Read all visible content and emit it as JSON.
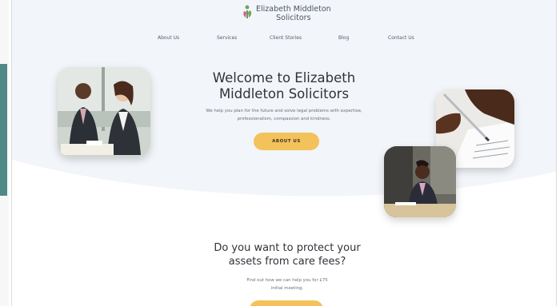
{
  "brand": {
    "name_line1": "Elizabeth Middleton",
    "name_line2": "Solicitors",
    "logo_icon": "leaf-icon",
    "colors": {
      "accent_yellow": "#f3c25b",
      "hero_bg": "#f2f5f9",
      "text_dark": "#2f3338",
      "logo_green": "#6aa84f",
      "logo_pink": "#d35d8a"
    }
  },
  "nav": {
    "items": [
      {
        "label": "About Us"
      },
      {
        "label": "Services"
      },
      {
        "label": "Client Stories"
      },
      {
        "label": "Blog"
      },
      {
        "label": "Contact Us"
      }
    ]
  },
  "hero": {
    "title_line1": "Welcome to Elizabeth",
    "title_line2": "Middleton Solicitors",
    "subtitle_line1": "We help you plan for the future and solve legal problems with expertise,",
    "subtitle_line2": "professionalism, compassion and kindness.",
    "button_label": "ABOUT US"
  },
  "section": {
    "title_line1": "Do you want to protect your",
    "title_line2": "assets from care fees?",
    "sub_line1": "Find out how we can help you for £75",
    "sub_line2": "initial meeting."
  }
}
